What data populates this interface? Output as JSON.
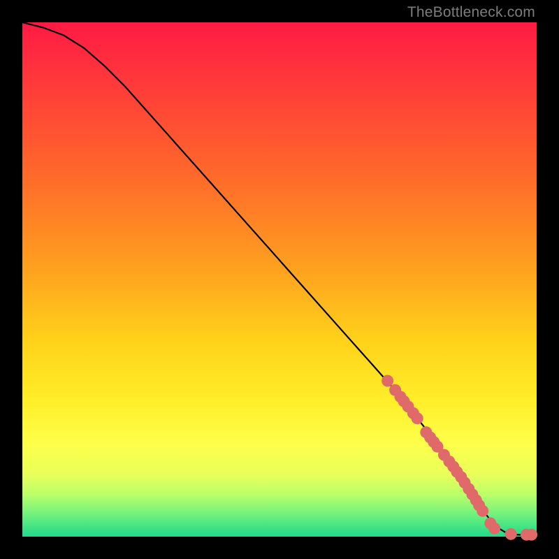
{
  "watermark": "TheBottleneck.com",
  "chart_data": {
    "type": "line",
    "title": "",
    "xlabel": "",
    "ylabel": "",
    "xlim": [
      0,
      100
    ],
    "ylim": [
      0,
      100
    ],
    "curve": {
      "name": "bottleneck-curve",
      "x": [
        0,
        4,
        8,
        12,
        16,
        20,
        24,
        28,
        32,
        36,
        40,
        44,
        48,
        52,
        56,
        60,
        64,
        68,
        72,
        76,
        80,
        84,
        86,
        88,
        90,
        92,
        94,
        96,
        98,
        100
      ],
      "y": [
        100,
        99,
        97.5,
        95,
        91.5,
        87.5,
        83,
        78.5,
        74,
        69.5,
        65,
        60.5,
        56,
        51.5,
        47,
        42.5,
        38,
        33.5,
        29,
        24,
        19,
        13.5,
        10.5,
        7.5,
        4.5,
        2.0,
        0.8,
        0.4,
        0.3,
        0.3
      ]
    },
    "series": [
      {
        "name": "data-points",
        "x": [
          71,
          72.5,
          73.5,
          74.2,
          75,
          76,
          76.8,
          78.5,
          79.3,
          80,
          80.7,
          82,
          83,
          83.8,
          84.5,
          85.3,
          86,
          86.8,
          87.5,
          88.2,
          88.8,
          89.5,
          91,
          91.8,
          95,
          98,
          99
        ],
        "y": [
          30.3,
          28.5,
          27.2,
          26.3,
          25.3,
          24,
          23,
          20.3,
          19.3,
          18.4,
          17.5,
          15.9,
          14.6,
          13.6,
          12.6,
          11.6,
          10.5,
          9.3,
          8.2,
          7.1,
          6.1,
          5.0,
          2.6,
          1.6,
          0.5,
          0.4,
          0.4
        ]
      }
    ],
    "background_gradient": {
      "type": "vertical",
      "stops": [
        {
          "pos": 0.0,
          "color": "#ff1a44"
        },
        {
          "pos": 0.5,
          "color": "#ffb61a"
        },
        {
          "pos": 0.82,
          "color": "#feff4a"
        },
        {
          "pos": 1.0,
          "color": "#1fd98a"
        }
      ]
    }
  }
}
